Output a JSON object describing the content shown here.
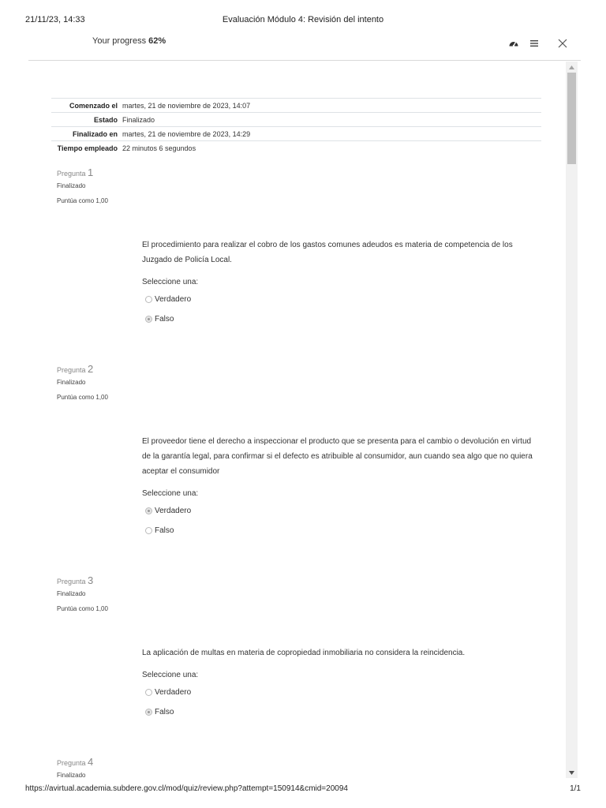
{
  "print_header": {
    "datetime": "21/11/23, 14:33",
    "title": "Evaluación Módulo 4: Revisión del intento"
  },
  "progress": {
    "label": "Your progress",
    "value": "62%"
  },
  "icons": {
    "dashboard": "dashboard-icon",
    "menu": "hamburger-menu-icon",
    "close": "close-icon"
  },
  "summary": [
    {
      "label": "Comenzado el",
      "value": "martes, 21 de noviembre de 2023, 14:07"
    },
    {
      "label": "Estado",
      "value": "Finalizado"
    },
    {
      "label": "Finalizado en",
      "value": "martes, 21 de noviembre de 2023, 14:29"
    },
    {
      "label": "Tiempo empleado",
      "value": "22 minutos 6 segundos"
    }
  ],
  "questions": [
    {
      "prefix": "Pregunta",
      "number": "1",
      "state": "Finalizado",
      "grade": "Puntúa como 1,00",
      "text": "El procedimiento para realizar el cobro de los gastos comunes adeudos es materia de competencia de los Juzgado de Policía Local.",
      "prompt": "Seleccione una:",
      "options": [
        {
          "label": "Verdadero",
          "checked": false
        },
        {
          "label": "Falso",
          "checked": true
        }
      ]
    },
    {
      "prefix": "Pregunta",
      "number": "2",
      "state": "Finalizado",
      "grade": "Puntúa como 1,00",
      "text": "El proveedor tiene el derecho a inspeccionar el producto que se presenta para el cambio o devolución en virtud de la garantía legal, para confirmar si el defecto es atribuible al consumidor, aun cuando sea algo que no quiera aceptar el consumidor",
      "prompt": "Seleccione una:",
      "options": [
        {
          "label": "Verdadero",
          "checked": true
        },
        {
          "label": "Falso",
          "checked": false
        }
      ]
    },
    {
      "prefix": "Pregunta",
      "number": "3",
      "state": "Finalizado",
      "grade": "Puntúa como 1,00",
      "text": "La aplicación de multas en materia de copropiedad inmobiliaria no considera la reincidencia.",
      "prompt": "Seleccione una:",
      "options": [
        {
          "label": "Verdadero",
          "checked": false
        },
        {
          "label": "Falso",
          "checked": true
        }
      ]
    },
    {
      "prefix": "Pregunta",
      "number": "4",
      "state": "Finalizado"
    }
  ],
  "print_footer": {
    "url": "https://avirtual.academia.subdere.gov.cl/mod/quiz/review.php?attempt=150914&cmid=20094",
    "page": "1/1"
  }
}
